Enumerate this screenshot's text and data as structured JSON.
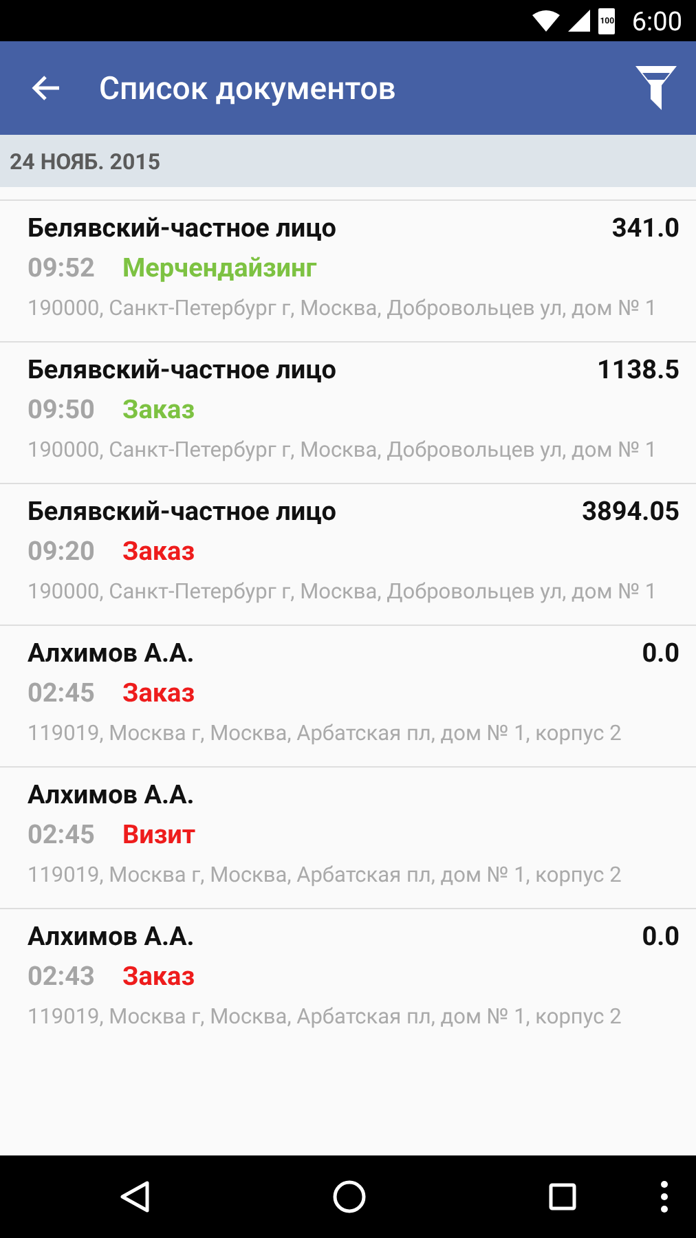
{
  "status_bar": {
    "battery": "100",
    "time": "6:00"
  },
  "app_bar": {
    "title": "Список документов"
  },
  "date_header": "24 НОЯБ. 2015",
  "documents": [
    {
      "client": "Белявский-частное лицо",
      "amount": "341.0",
      "time": "09:52",
      "type": "Мерчендайзинг",
      "color": "#7dc242",
      "address": "190000, Санкт-Петербург г, Москва, Добровольцев ул, дом № 1"
    },
    {
      "client": "Белявский-частное лицо",
      "amount": "1138.5",
      "time": "09:50",
      "type": "Заказ",
      "color": "#7dc242",
      "address": "190000, Санкт-Петербург г, Москва, Добровольцев ул, дом № 1"
    },
    {
      "client": "Белявский-частное лицо",
      "amount": "3894.05",
      "time": "09:20",
      "type": "Заказ",
      "color": "#ee1c1c",
      "address": "190000, Санкт-Петербург г, Москва, Добровольцев ул, дом № 1"
    },
    {
      "client": "Алхимов А.А.",
      "amount": "0.0",
      "time": "02:45",
      "type": "Заказ",
      "color": "#ee1c1c",
      "address": "119019, Москва г, Москва, Арбатская пл, дом № 1, корпус 2"
    },
    {
      "client": "Алхимов А.А.",
      "time": "02:45",
      "type": "Визит",
      "color": "#ee1c1c",
      "address": "119019, Москва г, Москва, Арбатская пл, дом № 1, корпус 2"
    },
    {
      "client": "Алхимов А.А.",
      "amount": "0.0",
      "time": "02:43",
      "type": "Заказ",
      "color": "#ee1c1c",
      "address": "119019, Москва г, Москва, Арбатская пл, дом № 1, корпус 2"
    }
  ]
}
